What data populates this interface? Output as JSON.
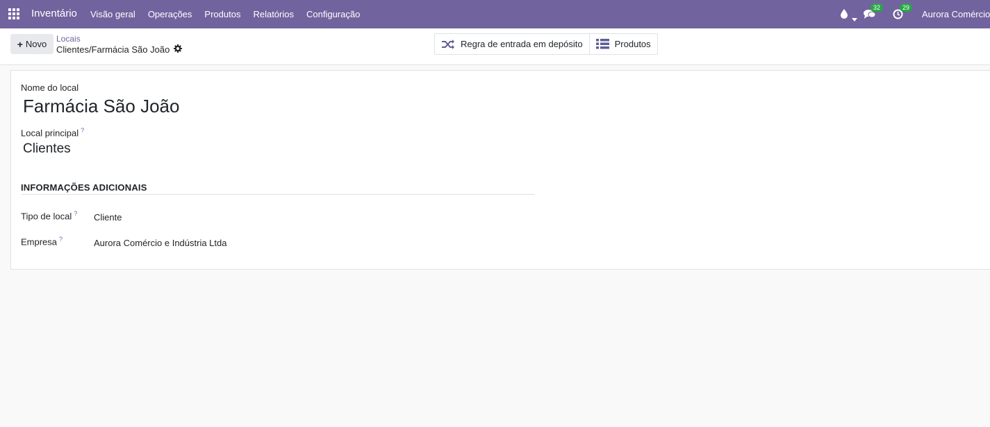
{
  "navbar": {
    "app_name": "Inventário",
    "menu": [
      "Visão geral",
      "Operações",
      "Produtos",
      "Relatórios",
      "Configuração"
    ],
    "messages_count": "32",
    "activities_count": "29",
    "user": "Aurora Comércio"
  },
  "control_panel": {
    "new_label": "Novo",
    "breadcrumb": "Locais",
    "record_title": "Clientes/Farmácia São João",
    "smart_buttons": {
      "putaway": "Regra de entrada em depósito",
      "products": "Produtos"
    }
  },
  "form": {
    "name_label": "Nome do local",
    "name_value": "Farmácia São João",
    "parent_label": "Local principal",
    "parent_value": "Clientes",
    "section_title": "INFORMAÇÕES ADICIONAIS",
    "type_label": "Tipo de local",
    "type_value": "Cliente",
    "company_label": "Empresa",
    "company_value": "Aurora Comércio e Indústria Ltda",
    "help_mark": "?"
  },
  "colors": {
    "brand": "#71639e",
    "badge": "#28a745"
  }
}
